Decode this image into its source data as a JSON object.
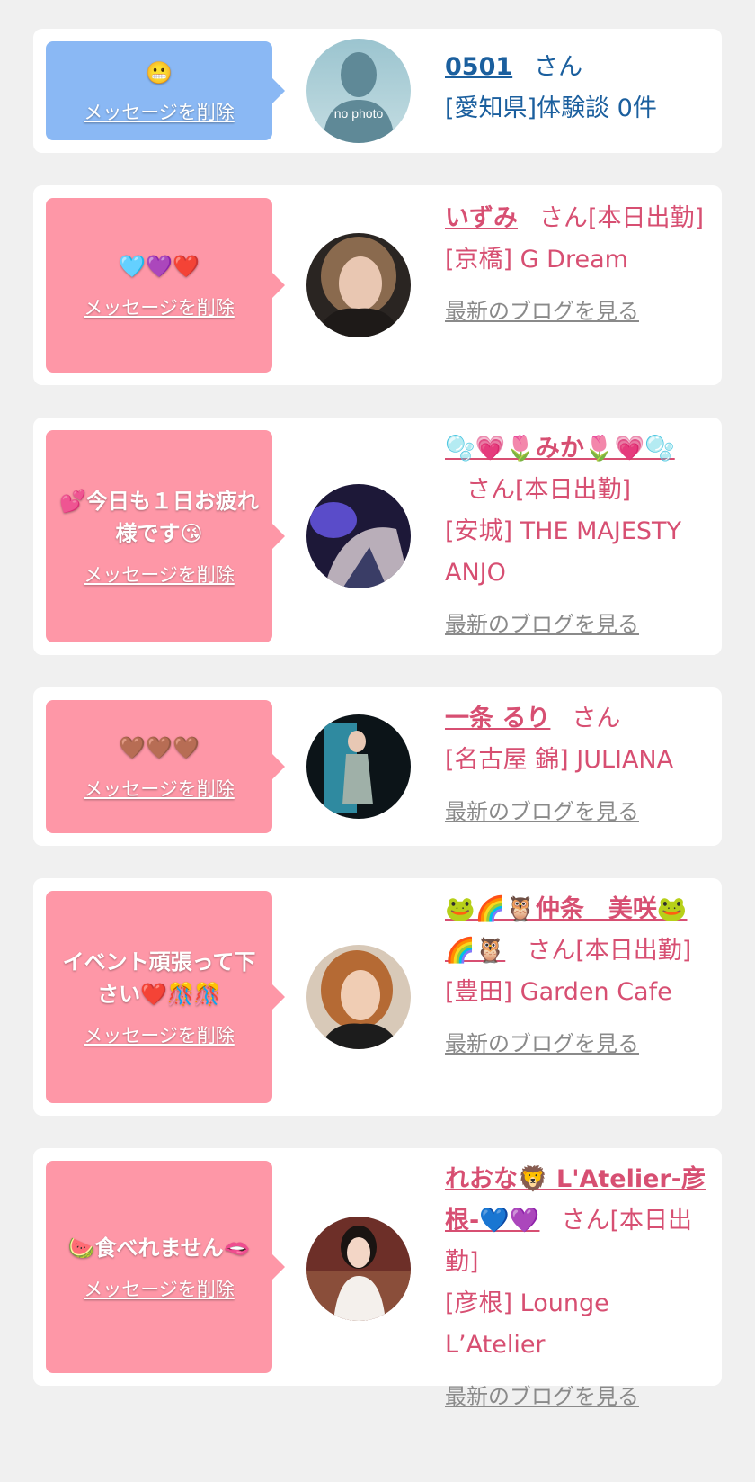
{
  "cards": [
    {
      "variant": "blue",
      "message": "😬",
      "delete_label": "メッセージを削除",
      "avatar": "no-photo",
      "avatar_text": "no photo",
      "name": "0501",
      "san": "さん",
      "shop": "[愛知県]体験談 0件",
      "blog": ""
    },
    {
      "variant": "pink",
      "message": "🩵💜❤️",
      "delete_label": "メッセージを削除",
      "avatar": "photo-brown-hair",
      "name": "いずみ",
      "san": "さん[本日出勤]",
      "shop": "[京橋] G Dream",
      "blog": "最新のブログを見る"
    },
    {
      "variant": "pink",
      "message": "💕今日も１日お疲れ様です😘",
      "delete_label": "メッセージを削除",
      "avatar": "photo-purple",
      "name": "🫧💗🌷みか🌷💗🫧",
      "san": "さん[本日出勤]",
      "shop": "[安城] THE MAJESTY ANJO",
      "blog": "最新のブログを見る"
    },
    {
      "variant": "pink",
      "message": "🤎🤎🤎",
      "delete_label": "メッセージを削除",
      "avatar": "photo-dark-studio",
      "name": "一条 るり",
      "san": "さん",
      "shop": "[名古屋 錦] JULIANA",
      "blog": "最新のブログを見る"
    },
    {
      "variant": "pink",
      "message": "イベント頑張って下さい❤️🎊🎊",
      "delete_label": "メッセージを削除",
      "avatar": "photo-orange-hair",
      "name": "🐸🌈🦉仲条　美咲🐸🌈🦉",
      "san": "さん[本日出勤]",
      "shop": "[豊田] Garden Cafe",
      "blog": "最新のブログを見る"
    },
    {
      "variant": "pink",
      "message": "🍉食べれません🫦",
      "delete_label": "メッセージを削除",
      "avatar": "photo-white-dress",
      "name": "れおな🦁 L'Atelier-彦根-💙💜",
      "san": "さん[本日出勤]",
      "shop": "[彦根] Lounge L’Atelier",
      "blog": "最新のブログを見る"
    }
  ],
  "colors": {
    "pink_bubble": "#fe97a7",
    "blue_bubble": "#8ab8f4",
    "name_pink": "#d74f72",
    "name_blue": "#1b5f9e",
    "blog_gray": "#8a8a8a"
  }
}
